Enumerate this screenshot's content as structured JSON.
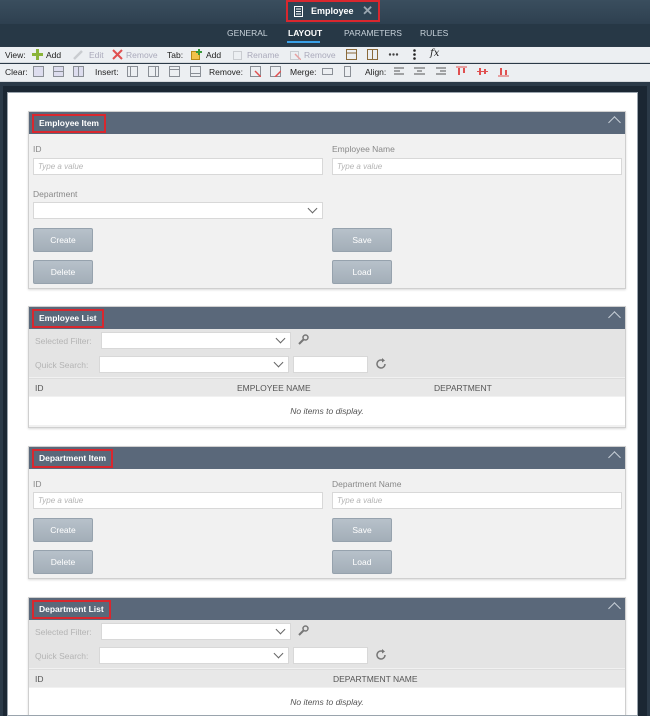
{
  "window": {
    "doc_tab_title": "Employee"
  },
  "tabs": [
    {
      "label": "GENERAL"
    },
    {
      "label": "LAYOUT"
    },
    {
      "label": "PARAMETERS"
    },
    {
      "label": "RULES"
    }
  ],
  "toolbar1": {
    "view_label": "View:",
    "add_label": "Add",
    "edit_label": "Edit",
    "remove_label": "Remove",
    "tab_label": "Tab:",
    "tab_add_label": "Add",
    "tab_rename_label": "Rename",
    "tab_remove_label": "Remove"
  },
  "toolbar2": {
    "clear_label": "Clear:",
    "insert_label": "Insert:",
    "remove_label": "Remove:",
    "merge_label": "Merge:",
    "align_label": "Align:"
  },
  "employee_item": {
    "title": "Employee Item",
    "id_label": "ID",
    "id_placeholder": "Type a value",
    "name_label": "Employee Name",
    "name_placeholder": "Type a value",
    "department_label": "Department",
    "create_label": "Create",
    "save_label": "Save",
    "delete_label": "Delete",
    "load_label": "Load"
  },
  "employee_list": {
    "title": "Employee List",
    "filter_label": "Selected Filter:",
    "search_label": "Quick Search:",
    "columns": [
      "ID",
      "EMPLOYEE NAME",
      "DEPARTMENT"
    ],
    "empty_text": "No items to display."
  },
  "department_item": {
    "title": "Department Item",
    "id_label": "ID",
    "id_placeholder": "Type a value",
    "name_label": "Department Name",
    "name_placeholder": "Type a value",
    "create_label": "Create",
    "save_label": "Save",
    "delete_label": "Delete",
    "load_label": "Load"
  },
  "department_list": {
    "title": "Department List",
    "filter_label": "Selected Filter:",
    "search_label": "Quick Search:",
    "columns": [
      "ID",
      "DEPARTMENT NAME"
    ],
    "empty_text": "No items to display."
  },
  "colors": {
    "accent": "#3aa0e6",
    "panel_header": "#5a687a",
    "highlight": "#d9272e",
    "button": "#a9b4be"
  }
}
